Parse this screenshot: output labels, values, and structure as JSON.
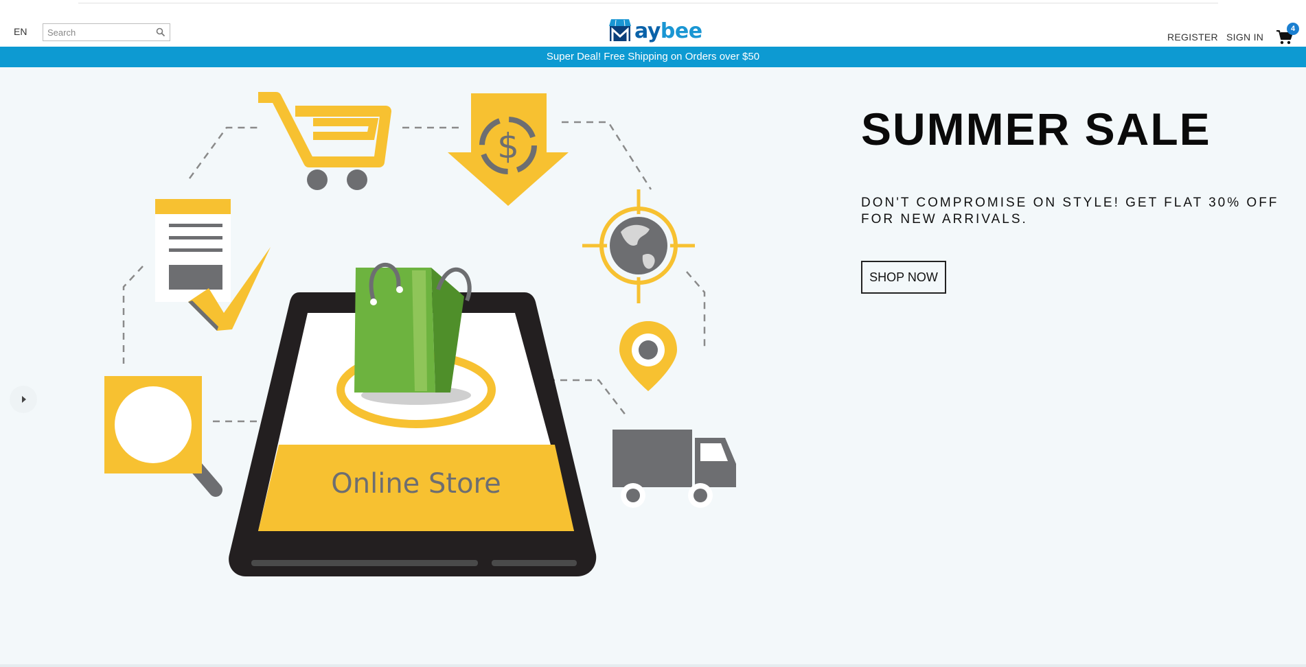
{
  "header": {
    "language": "EN",
    "search_placeholder": "Search",
    "logo": {
      "m": "M",
      "ay": "ay",
      "bee": "bee"
    },
    "register": "REGISTER",
    "sign_in": "SIGN IN",
    "cart_count": "4"
  },
  "promo": {
    "text": "Super Deal! Free Shipping on Orders over $50"
  },
  "hero": {
    "title": "SUMMER SALE",
    "subtitle": "DON'T COMPROMISE ON STYLE! GET FLAT 30% OFF FOR NEW ARRIVALS.",
    "cta": "SHOP NOW",
    "illustration_label": "Online Store"
  },
  "colors": {
    "accent_blue": "#0d9ad2",
    "illustration_yellow": "#f7c131",
    "illustration_gray": "#6d6e71"
  },
  "icons": [
    "search-icon",
    "cart-icon",
    "slider-prev-icon"
  ]
}
